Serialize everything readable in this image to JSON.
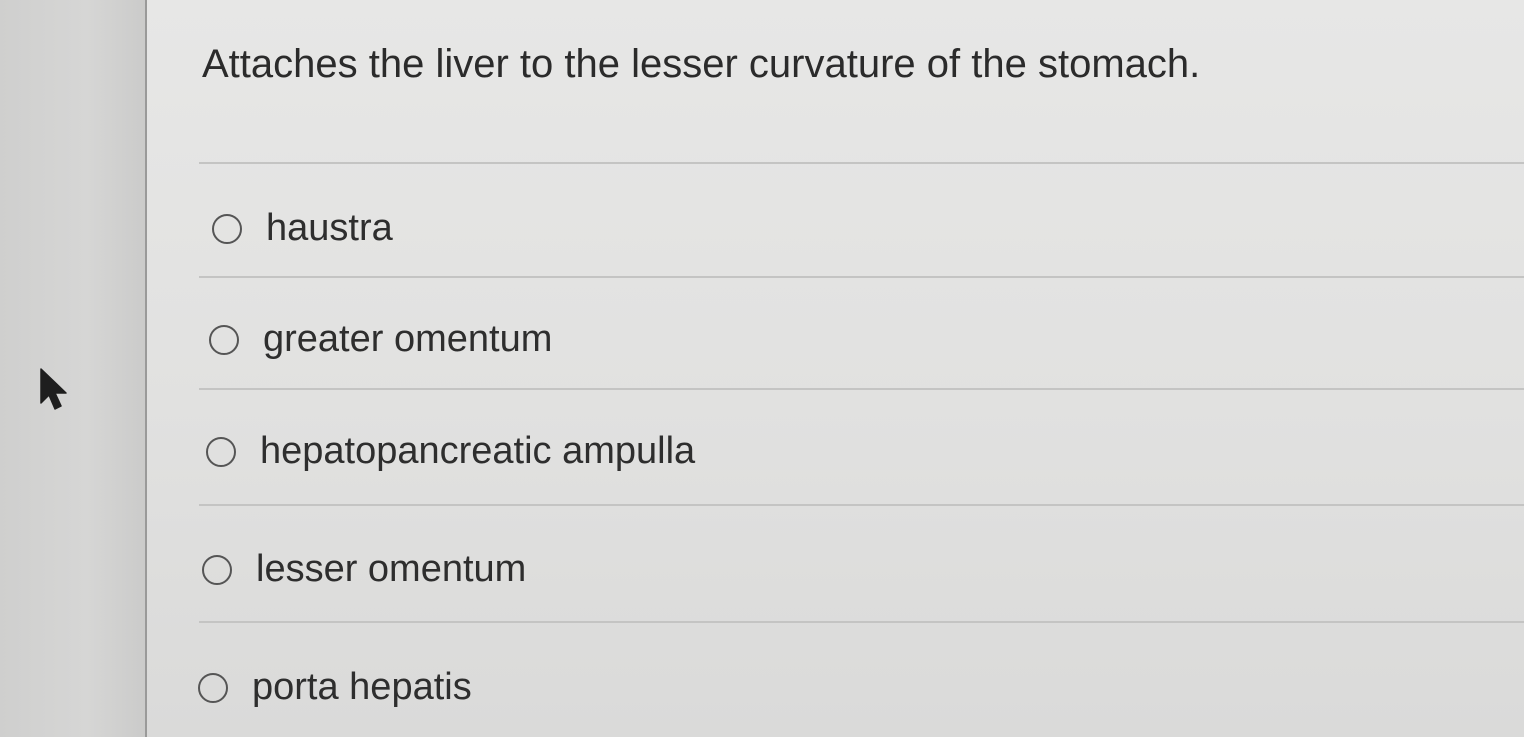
{
  "question": {
    "text": "Attaches the liver to the lesser curvature of the stomach."
  },
  "options": [
    {
      "label": "haustra",
      "selected": false
    },
    {
      "label": "greater omentum",
      "selected": false
    },
    {
      "label": "hepatopancreatic ampulla",
      "selected": false
    },
    {
      "label": "lesser omentum",
      "selected": false
    },
    {
      "label": "porta hepatis",
      "selected": false
    }
  ],
  "icons": {
    "cursor": "mouse-pointer-icon",
    "radio": "radio-unchecked-icon"
  },
  "colors": {
    "panel_background": "#e4e4e3",
    "text": "#2b2b2b",
    "radio_border": "#555555",
    "divider": "#c4c4c3"
  }
}
